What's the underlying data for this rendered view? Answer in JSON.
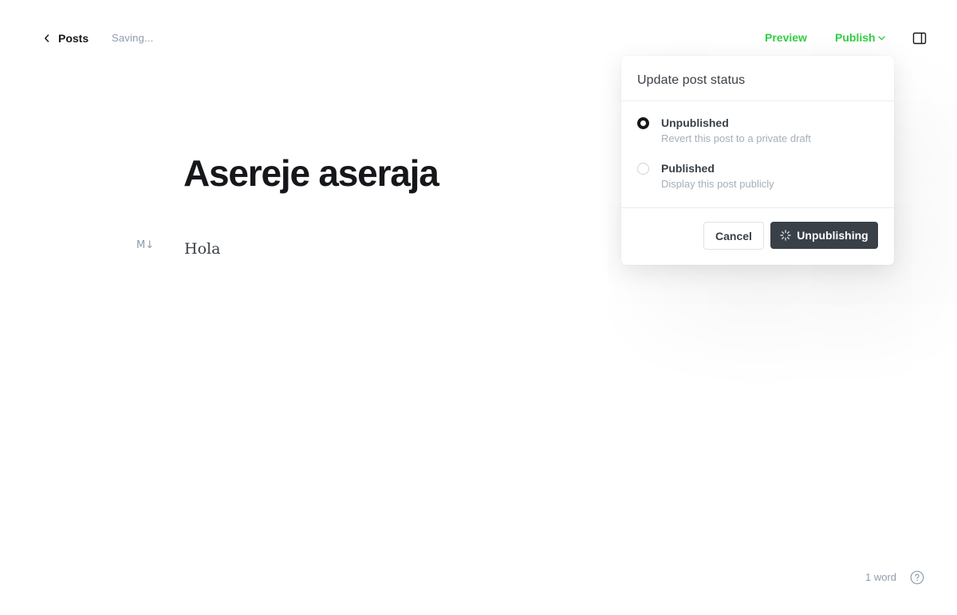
{
  "header": {
    "back_label": "Posts",
    "status_text": "Saving...",
    "preview_label": "Preview",
    "publish_label": "Publish"
  },
  "editor": {
    "title": "Asereje aseraja",
    "markdown_icon": "M↓",
    "body": "Hola"
  },
  "popover": {
    "title": "Update post status",
    "options": [
      {
        "label": "Unpublished",
        "description": "Revert this post to a private draft",
        "selected": true
      },
      {
        "label": "Published",
        "description": "Display this post publicly",
        "selected": false
      }
    ],
    "cancel_label": "Cancel",
    "confirm_label": "Unpublishing"
  },
  "footer": {
    "word_count": "1 word",
    "help_icon": "question-circle-icon"
  },
  "colors": {
    "accent": "#30cf43",
    "text": "#15171a",
    "muted": "#8e9cac",
    "button_dark": "#394047"
  }
}
